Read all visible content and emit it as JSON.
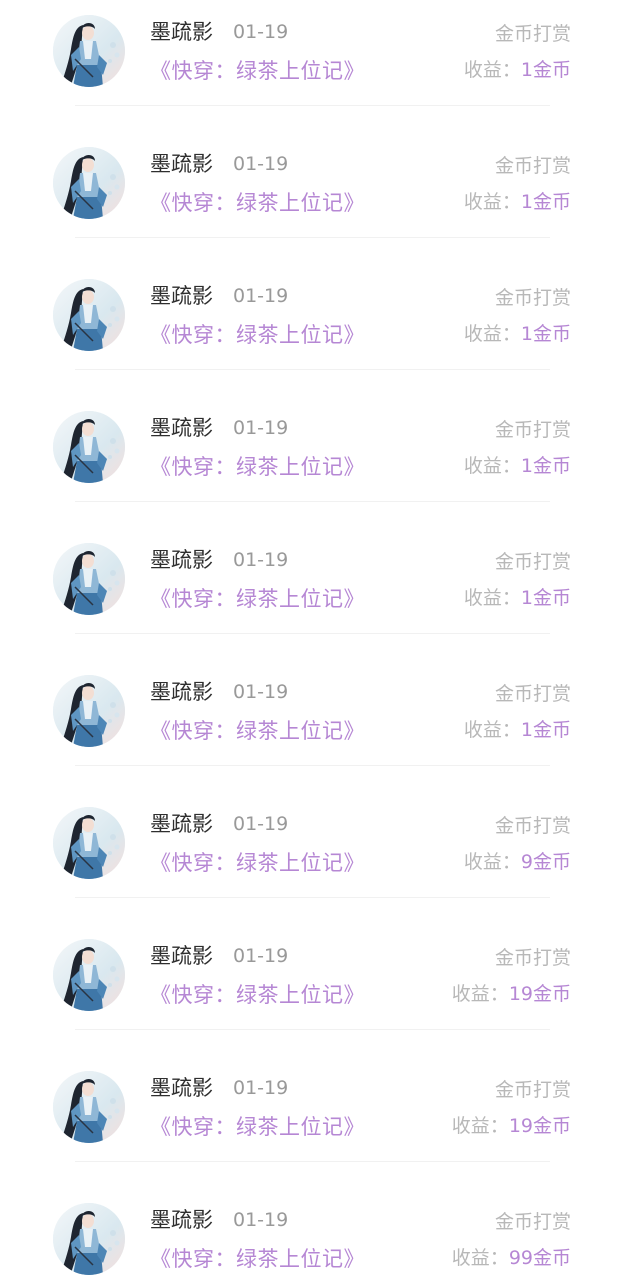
{
  "rows": [
    {
      "name": "墨疏影",
      "date": "01-19",
      "book": "《快穿：绿茶上位记》",
      "type": "金币打赏",
      "income_label": "收益：",
      "income_amount": "1金币"
    },
    {
      "name": "墨疏影",
      "date": "01-19",
      "book": "《快穿：绿茶上位记》",
      "type": "金币打赏",
      "income_label": "收益：",
      "income_amount": "1金币"
    },
    {
      "name": "墨疏影",
      "date": "01-19",
      "book": "《快穿：绿茶上位记》",
      "type": "金币打赏",
      "income_label": "收益：",
      "income_amount": "1金币"
    },
    {
      "name": "墨疏影",
      "date": "01-19",
      "book": "《快穿：绿茶上位记》",
      "type": "金币打赏",
      "income_label": "收益：",
      "income_amount": "1金币"
    },
    {
      "name": "墨疏影",
      "date": "01-19",
      "book": "《快穿：绿茶上位记》",
      "type": "金币打赏",
      "income_label": "收益：",
      "income_amount": "1金币"
    },
    {
      "name": "墨疏影",
      "date": "01-19",
      "book": "《快穿：绿茶上位记》",
      "type": "金币打赏",
      "income_label": "收益：",
      "income_amount": "1金币"
    },
    {
      "name": "墨疏影",
      "date": "01-19",
      "book": "《快穿：绿茶上位记》",
      "type": "金币打赏",
      "income_label": "收益：",
      "income_amount": "9金币"
    },
    {
      "name": "墨疏影",
      "date": "01-19",
      "book": "《快穿：绿茶上位记》",
      "type": "金币打赏",
      "income_label": "收益：",
      "income_amount": "19金币"
    },
    {
      "name": "墨疏影",
      "date": "01-19",
      "book": "《快穿：绿茶上位记》",
      "type": "金币打赏",
      "income_label": "收益：",
      "income_amount": "19金币"
    },
    {
      "name": "墨疏影",
      "date": "01-19",
      "book": "《快穿：绿茶上位记》",
      "type": "金币打赏",
      "income_label": "收益：",
      "income_amount": "99金币"
    }
  ],
  "colors": {
    "accent": "#b687d4",
    "muted": "#b8b8b8",
    "name": "#2e2e2e",
    "date": "#999999"
  },
  "icons": {
    "avatar": "user-avatar-illustration"
  }
}
